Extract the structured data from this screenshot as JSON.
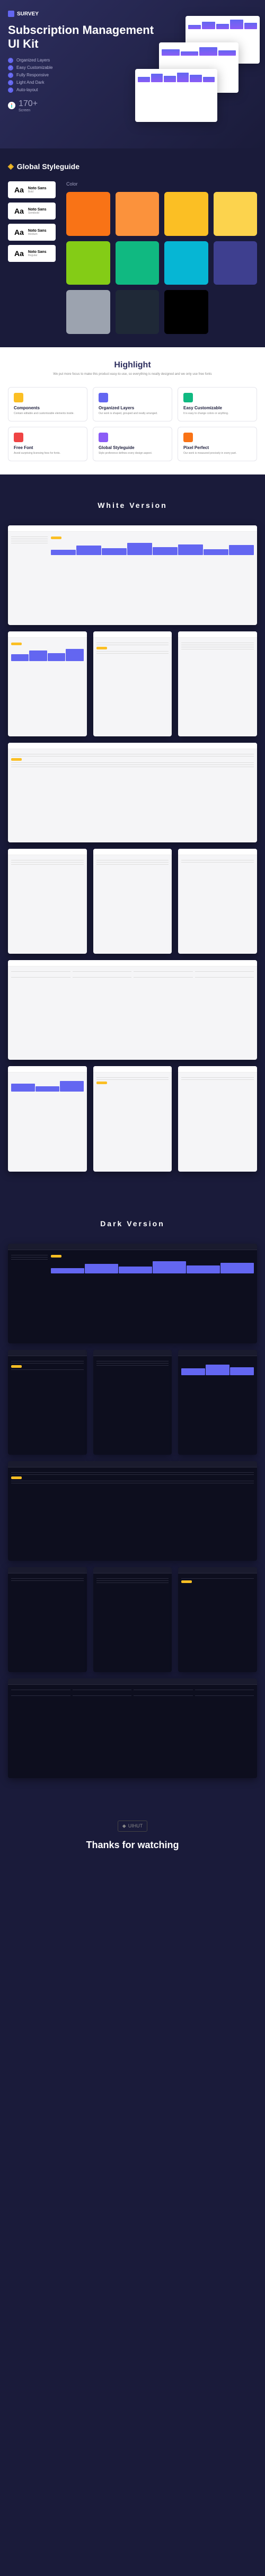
{
  "brand": "SURVEY",
  "hero": {
    "title": "Subscription Management",
    "subtitle": "UI Kit",
    "features": [
      "Organized Layers",
      "Easy Customizable",
      "Fully Responsive",
      "Light And Dark",
      "Auto-layout"
    ],
    "screenCount": "170+",
    "screenLabel": "Screen"
  },
  "styleguide": {
    "title": "Global Styleguide",
    "fonts": [
      {
        "name": "Noto Sans",
        "weight": "Bold"
      },
      {
        "name": "Noto Sans",
        "weight": "Semibold"
      },
      {
        "name": "Noto Sans",
        "weight": "Medium"
      },
      {
        "name": "Noto Sans",
        "weight": "Regular"
      }
    ],
    "colorLabel": "Color",
    "colors": [
      "#f97316",
      "#fb923c",
      "#fbbf24",
      "#fcd34d",
      "#84cc16",
      "#10b981",
      "#06b6d4",
      "#3e3f8f",
      "#9ca3af",
      "#1f2937",
      "#000000"
    ]
  },
  "highlight": {
    "title": "Highlight",
    "subtitle": "We put more focus to make this product easy-to-use, so everything is neatly designed and we only use free fonts",
    "cards": [
      {
        "title": "Components",
        "desc": "Contain editable and customizable elements inside.",
        "color": "#fbbf24"
      },
      {
        "title": "Organized Layers",
        "desc": "Our work is shaped, grouped and neatly arranged.",
        "color": "#6366f1"
      },
      {
        "title": "Easy Customizable",
        "desc": "It is easy to change colors or anything.",
        "color": "#10b981"
      },
      {
        "title": "Free Font",
        "desc": "Avoid surprising licensing fees for fonts.",
        "color": "#ef4444"
      },
      {
        "title": "Global Styleguide",
        "desc": "Style preference defines every design aspect.",
        "color": "#8b5cf6"
      },
      {
        "title": "Pixel Perfect",
        "desc": "Our work is measured precisely in every part.",
        "color": "#f97316"
      }
    ]
  },
  "versions": {
    "white": "White Version",
    "dark": "Dark Version"
  },
  "footer": {
    "brand": "UIHUT",
    "thanks": "Thanks for watching"
  }
}
